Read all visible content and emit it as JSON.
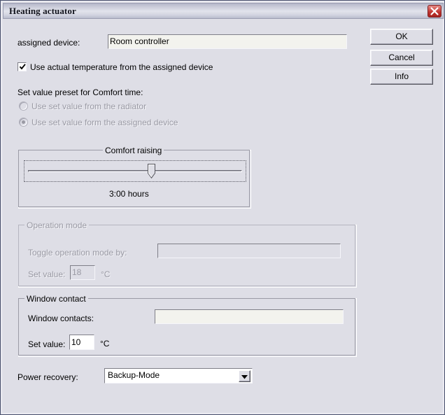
{
  "window": {
    "title": "Heating actuator",
    "close_icon": "close-x-icon"
  },
  "buttons": {
    "ok": "OK",
    "cancel": "Cancel",
    "info": "Info"
  },
  "assigned_device": {
    "label": "assigned device:",
    "value": "Room controller"
  },
  "use_actual_temp": {
    "label": "Use actual temperature from the assigned device",
    "checked": true,
    "check_icon": "checkmark-icon"
  },
  "set_value_preset": {
    "heading": "Set value preset for Comfort time:",
    "options": [
      {
        "label": "Use set value from the radiator",
        "selected": false,
        "disabled": true
      },
      {
        "label": "Use set value form the assigned device",
        "selected": true,
        "disabled": true
      }
    ]
  },
  "comfort_raising": {
    "title": "Comfort raising",
    "value_text": "3:00 hours",
    "slider_percent": 56
  },
  "operation_mode": {
    "title": "Operation mode",
    "disabled": true,
    "toggle_label": "Toggle operation mode by:",
    "toggle_value": "",
    "set_value_label": "Set value:",
    "set_value": "18",
    "unit": "°C"
  },
  "window_contact": {
    "title": "Window contact",
    "contacts_label": "Window contacts:",
    "contacts_value": "",
    "set_value_label": "Set value:",
    "set_value": "10",
    "unit": "°C"
  },
  "power_recovery": {
    "label": "Power recovery:",
    "selected": "Backup-Mode",
    "arrow_icon": "chevron-down-icon"
  },
  "colors": {
    "dialog_bg": "#dedee6",
    "border": "#4c5470",
    "close_red": "#bd332f",
    "disabled_text": "#9a9aa4"
  }
}
